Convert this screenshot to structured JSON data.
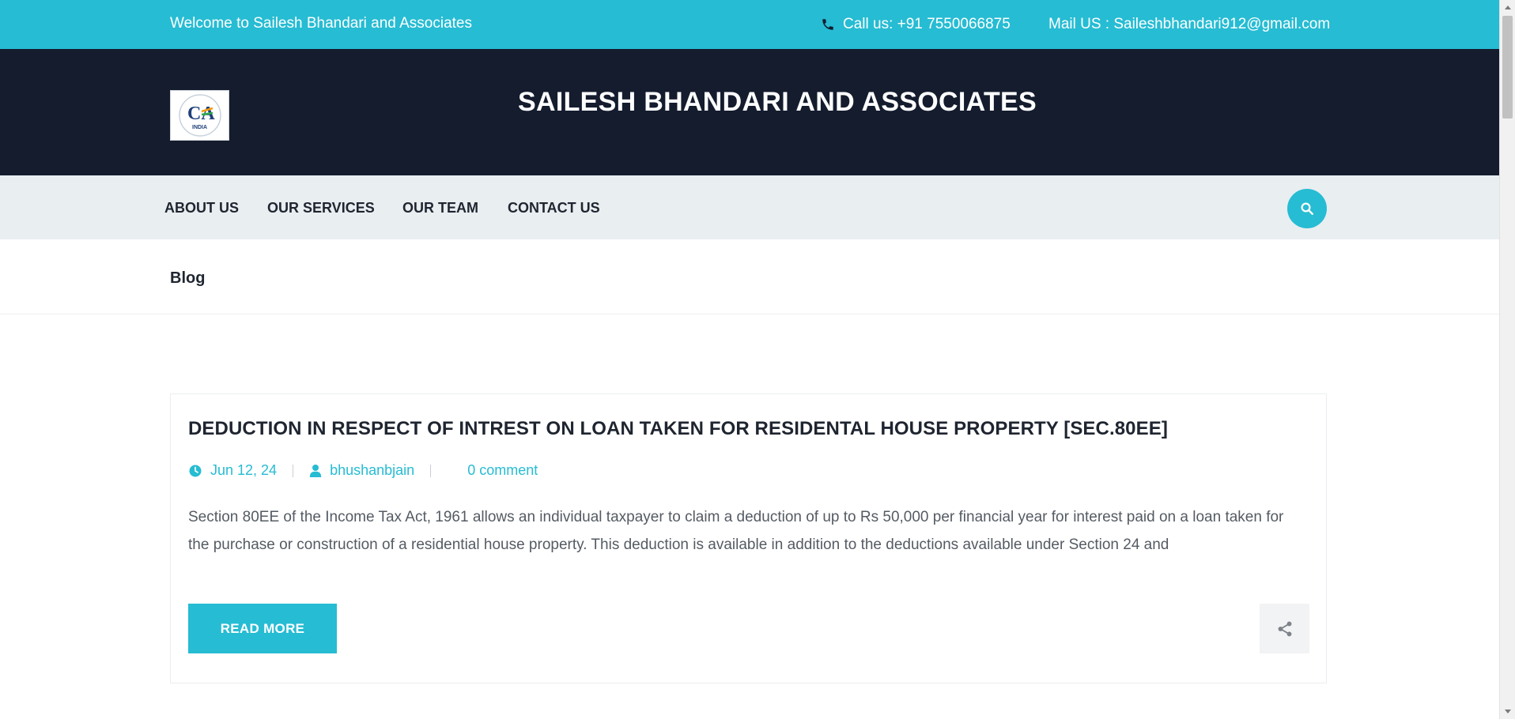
{
  "topbar": {
    "welcome": "Welcome to Sailesh Bhandari and Associates",
    "call": "Call us: +91 7550066875",
    "mail": "Mail US : Saileshbhandari912@gmail.com"
  },
  "header": {
    "logo_text": "CA",
    "logo_subtext": "INDIA",
    "site_title": "SAILESH BHANDARI AND ASSOCIATES"
  },
  "nav": {
    "items": [
      {
        "label": "ABOUT US"
      },
      {
        "label": "OUR SERVICES"
      },
      {
        "label": "OUR TEAM"
      },
      {
        "label": "CONTACT US"
      }
    ],
    "search_icon": "search-icon"
  },
  "breadcrumb": {
    "title": "Blog"
  },
  "post": {
    "title": "DEDUCTION IN RESPECT OF INTREST ON LOAN TAKEN FOR RESIDENTAL HOUSE PROPERTY [SEC.80EE]",
    "date": "Jun 12, 24",
    "author": "bhushanbjain",
    "comments": "0 comment",
    "excerpt": "Section 80EE of the Income Tax Act, 1961 allows an individual taxpayer to claim a deduction of up to Rs 50,000 per financial year for interest paid on a loan taken for the purchase or construction of a residential house property. This deduction is available in addition to the deductions available under Section 24 and",
    "read_more": "READ MORE"
  },
  "colors": {
    "accent": "#26bcd3",
    "header_bg": "#141c2e",
    "nav_bg": "#e9eef1"
  }
}
